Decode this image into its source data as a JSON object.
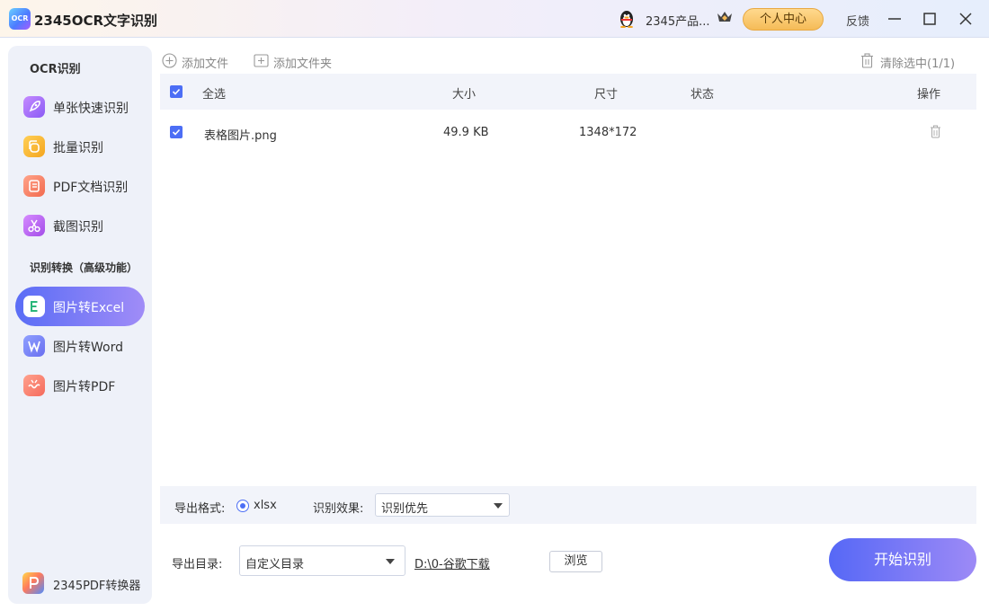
{
  "window": {
    "title": "2345OCR文字识别",
    "logo_text": "OCR",
    "user_name": "2345产品...",
    "profile_button": "个人中心",
    "feedback": "反馈"
  },
  "sidebar": {
    "section_ocr": "OCR识别",
    "ocr_items": [
      {
        "label": "单张快速识别",
        "icon": "rocket-icon"
      },
      {
        "label": "批量识别",
        "icon": "batch-icon"
      },
      {
        "label": "PDF文档识别",
        "icon": "pdf-doc-icon"
      },
      {
        "label": "截图识别",
        "icon": "scissors-icon"
      }
    ],
    "section_convert": "识别转换（高级功能）",
    "convert_items": [
      {
        "label": "图片转Excel",
        "icon": "excel-icon",
        "active": true
      },
      {
        "label": "图片转Word",
        "icon": "word-icon"
      },
      {
        "label": "图片转PDF",
        "icon": "pdf-convert-icon"
      }
    ],
    "bottom_label": "2345PDF转换器"
  },
  "toolbar": {
    "add_file": "添加文件",
    "add_folder": "添加文件夹",
    "clear_selected": "清除选中(1/1)"
  },
  "table": {
    "headers": {
      "select_all": "全选",
      "size": "大小",
      "dimensions": "尺寸",
      "status": "状态",
      "actions": "操作"
    },
    "rows": [
      {
        "name": "表格图片.png",
        "size": "49.9 KB",
        "dimensions": "1348*172",
        "status": "",
        "checked": true
      }
    ]
  },
  "options": {
    "format_label": "导出格式:",
    "format_value": "xlsx",
    "effect_label": "识别效果:",
    "effect_value": "识别优先"
  },
  "output": {
    "dir_label": "导出目录:",
    "dir_select": "自定义目录",
    "dir_path": "D:\\0-谷歌下载",
    "browse": "浏览",
    "start": "开始识别"
  },
  "colors": {
    "accent": "#4c6ef5",
    "gradient_start": "#5668f6",
    "gradient_end": "#9d8af6",
    "profile_gold": "#f5bb57"
  }
}
